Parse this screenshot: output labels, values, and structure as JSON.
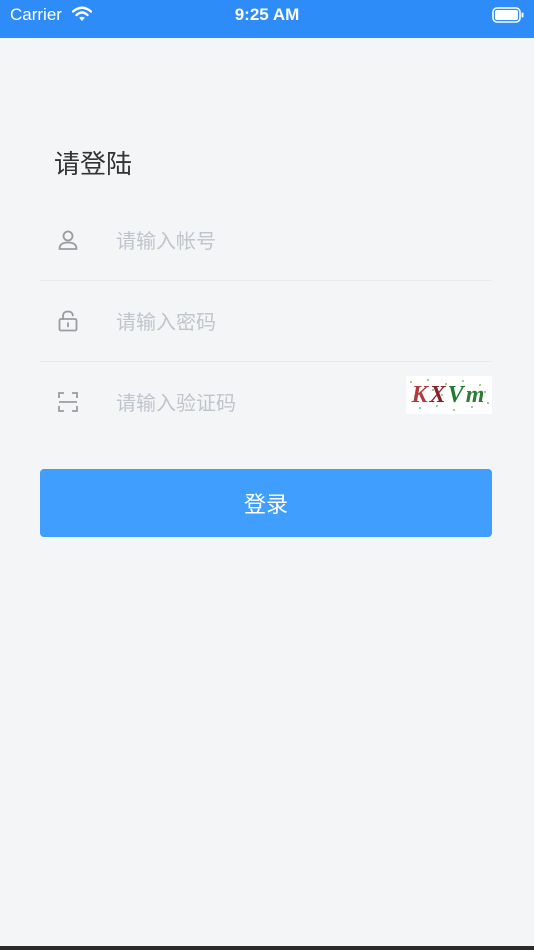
{
  "status_bar": {
    "carrier": "Carrier",
    "time": "9:25 AM",
    "wifi_icon": "wifi-icon",
    "battery_icon": "battery-full-icon",
    "background_color": "#2d8cf7"
  },
  "login": {
    "title": "请登陆",
    "account": {
      "placeholder": "请输入帐号",
      "value": "",
      "icon": "user-icon"
    },
    "password": {
      "placeholder": "请输入密码",
      "value": "",
      "icon": "unlock-icon"
    },
    "captcha": {
      "placeholder": "请输入验证码",
      "value": "",
      "icon": "scan-icon",
      "image_text": [
        "K",
        "X",
        "V",
        "m"
      ]
    },
    "submit_label": "登录",
    "accent_color": "#409eff"
  }
}
